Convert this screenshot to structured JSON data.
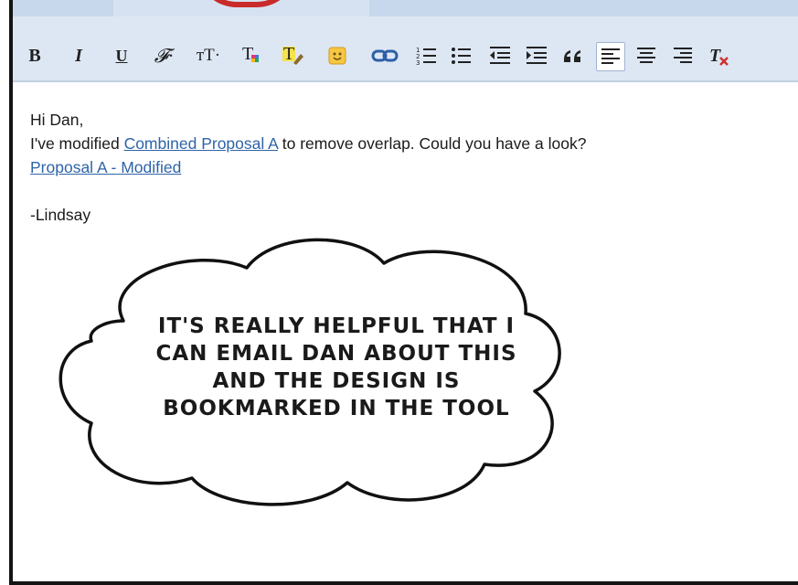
{
  "toolbar": {
    "bold": "B",
    "italic": "I",
    "underline": "U",
    "font_family": "𝓕·",
    "font_size": "тT·",
    "buttons": [
      "bold",
      "italic",
      "underline",
      "font",
      "size",
      "text-color",
      "highlight",
      "emoji",
      "link",
      "numbered-list",
      "bulleted-list",
      "indent-less",
      "indent-more",
      "quote",
      "align-left",
      "align-center",
      "align-right",
      "remove-formatting"
    ]
  },
  "email": {
    "greeting": "Hi Dan,",
    "line1_before": "I've modified ",
    "line1_link": "Combined Proposal A",
    "line1_after": " to remove overlap. Could you have a look?",
    "line2_link": "Proposal A - Modified",
    "signature": "-Lindsay"
  },
  "thought_bubble": {
    "lines": [
      "It's really helpful that I",
      "can email Dan about this",
      "and the design is",
      "bookmarked in the tool"
    ]
  },
  "colors": {
    "toolbar_bg": "#dde7f4",
    "link": "#2f64a8",
    "frame": "#141414",
    "badge": "#c92a2a"
  }
}
